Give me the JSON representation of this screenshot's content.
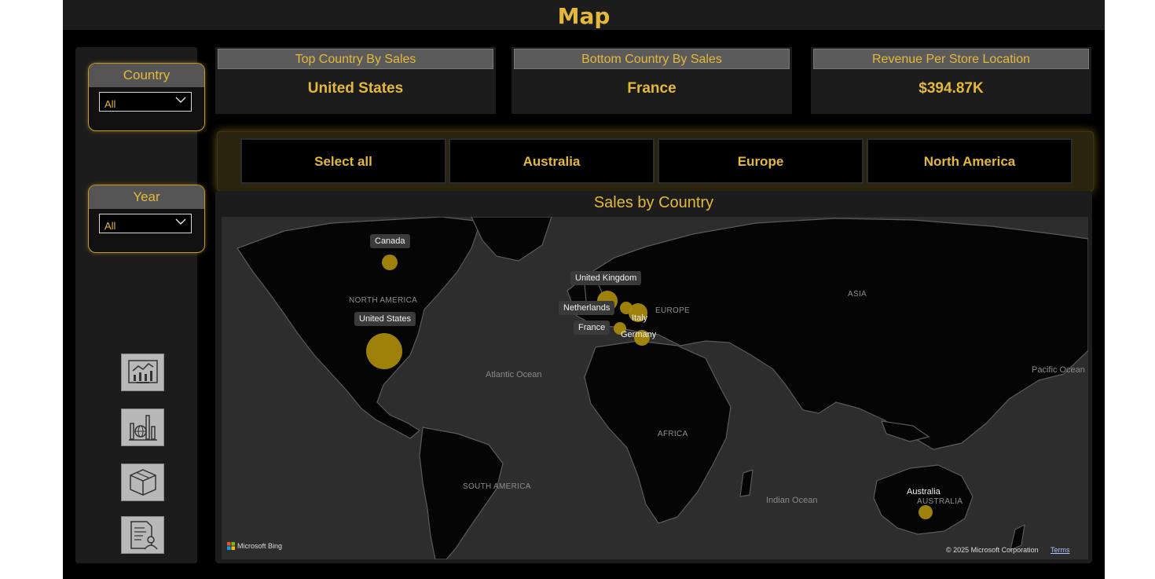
{
  "page": {
    "title": "Map"
  },
  "filters": {
    "country": {
      "label": "Country",
      "value": "All"
    },
    "year": {
      "label": "Year",
      "value": "All"
    }
  },
  "nav_buttons": [
    {
      "icon": "analytics-dashboard-icon"
    },
    {
      "icon": "global-bar-chart-icon"
    },
    {
      "icon": "product-box-icon"
    },
    {
      "icon": "customer-report-icon"
    }
  ],
  "kpis": [
    {
      "label": "Top Country By Sales",
      "value": "United States"
    },
    {
      "label": "Bottom Country By Sales",
      "value": "France"
    },
    {
      "label": "Revenue Per Store Location",
      "value": "$394.87K"
    }
  ],
  "region_tabs": [
    "Select all",
    "Australia",
    "Europe",
    "North America"
  ],
  "map": {
    "title": "Sales by Country",
    "country_labels": {
      "canada": "Canada",
      "united_states": "United States",
      "united_kingdom": "United Kingdom",
      "netherlands": "Netherlands",
      "france": "France",
      "italy": "Italy",
      "germany": "Germany",
      "australia": "Australia"
    },
    "region_labels": {
      "north_america": "NORTH AMERICA",
      "south_america": "SOUTH AMERICA",
      "europe": "EUROPE",
      "asia": "ASIA",
      "africa": "AFRICA",
      "australia": "AUSTRALIA"
    },
    "ocean_labels": {
      "atlantic": "Atlantic Ocean",
      "indian": "Indian Ocean",
      "pacific": "Pacific Ocean"
    },
    "provider": "Microsoft Bing",
    "copyright": "© 2025 Microsoft Corporation",
    "terms": "Terms"
  },
  "colors": {
    "accent": "#e4b83a",
    "bubble": "#a6880c",
    "panel": "#1c1c1c",
    "background": "#000000"
  }
}
